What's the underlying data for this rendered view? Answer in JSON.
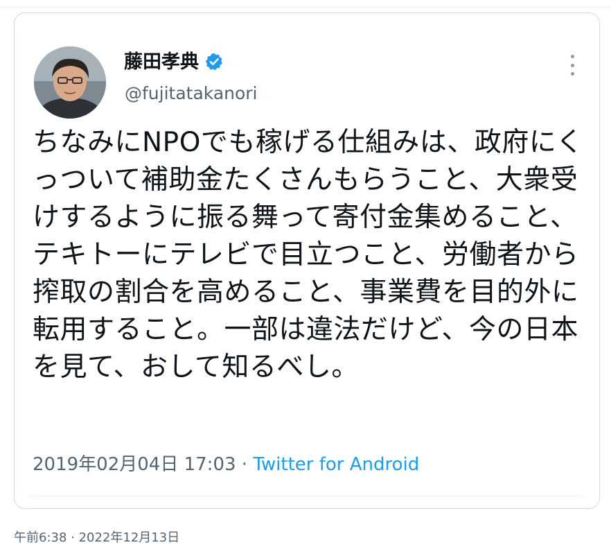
{
  "tweet": {
    "display_name": "藤田孝典",
    "handle": "@fujitatakanori",
    "verified_icon": "verified-badge-icon",
    "text": "ちなみにNPOでも稼げる仕組みは、政府にくっついて補助金たくさんもらうこと、大衆受けするように振る舞って寄付金集めること、テキトーにテレビで目立つこと、労働者から搾取の割合を高めること、事業費を目的外に転用すること。一部は違法だけど、今の日本を見て、おして知るべし。",
    "timestamp": "2019年02月04日 17:03",
    "separator": " · ",
    "source": "Twitter for Android"
  },
  "footer": {
    "date": "午前6:38 · 2022年12月13日"
  },
  "colors": {
    "text_primary": "#0f1419",
    "text_secondary": "#536471",
    "link": "#1d9bf0",
    "border": "#cfd9de"
  }
}
